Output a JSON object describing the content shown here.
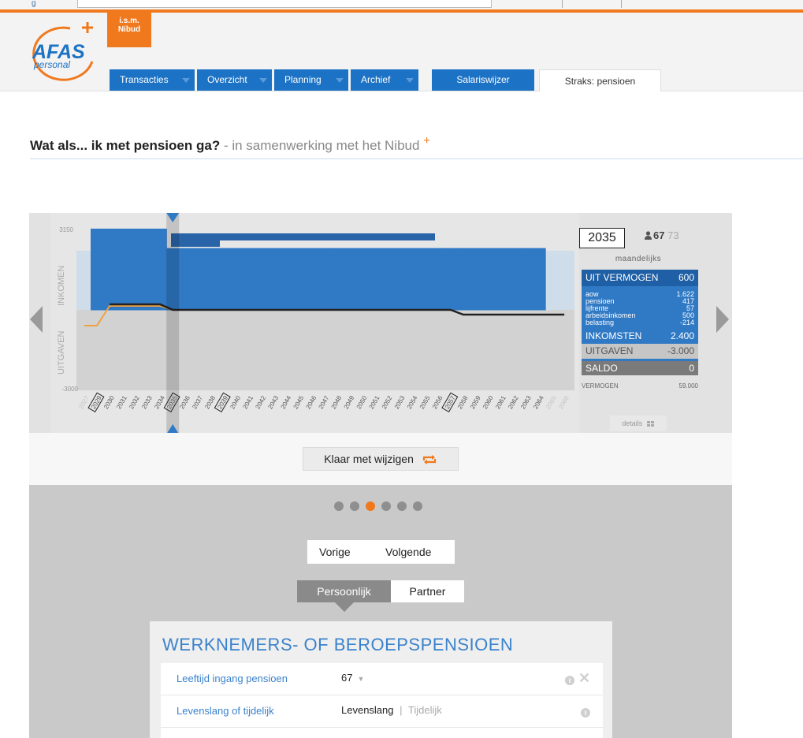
{
  "header": {
    "top_fragment": "g",
    "brand_logo": "AFAS",
    "brand_sub": "personal",
    "badge_line1": "i.s.m.",
    "badge_line2": "Nibud",
    "tabs": [
      {
        "label": "Transacties"
      },
      {
        "label": "Overzicht"
      },
      {
        "label": "Planning"
      },
      {
        "label": "Archief"
      },
      {
        "label": "Salariswijzer"
      },
      {
        "label": "Straks: pensioen"
      }
    ]
  },
  "page": {
    "title_bold": "Wat als... ik met pensioen ga?",
    "title_sub": " - in samenwerking met het Nibud",
    "title_plus": "+"
  },
  "chart_data": {
    "type": "area",
    "ytop_label": "3150",
    "ybottom_label": "-3000",
    "label_inkomen": "INKOMEN",
    "label_uitgaven": "UITGAVEN",
    "ylim": [
      -3000,
      3150
    ],
    "selected_year": "2035",
    "marked_years": [
      "2029",
      "2035",
      "2039",
      "2057"
    ],
    "x": [
      "2027",
      "2029",
      "2030",
      "2031",
      "2032",
      "2033",
      "2034",
      "2035",
      "2036",
      "2037",
      "2038",
      "2039",
      "2040",
      "2041",
      "2042",
      "2043",
      "2044",
      "2045",
      "2046",
      "2047",
      "2048",
      "2049",
      "2050",
      "2051",
      "2052",
      "2053",
      "2054",
      "2055",
      "2056",
      "2057",
      "2058",
      "2059",
      "2060",
      "2061",
      "2062",
      "2063",
      "2064",
      "2065",
      "2066"
    ],
    "series": [
      {
        "name": "inkomsten",
        "values": [
          null,
          3150,
          3150,
          3150,
          3150,
          3150,
          3150,
          2400,
          2400,
          2400,
          2400,
          2400,
          2400,
          2400,
          2400,
          2400,
          2400,
          2400,
          2400,
          2400,
          2400,
          2400,
          2400,
          2400,
          2400,
          2400,
          2400,
          2400,
          2400,
          2400,
          2400,
          2400,
          2400,
          2400,
          2400,
          2400,
          2400,
          null,
          null
        ]
      },
      {
        "name": "uitgaven",
        "values": [
          -300,
          -300,
          -3300,
          -3300,
          -3300,
          -3300,
          -3300,
          -3000,
          -3000,
          -3000,
          -3000,
          -3000,
          -3000,
          -3000,
          -3000,
          -3000,
          -3000,
          -3000,
          -3000,
          -3000,
          -3000,
          -3000,
          -3000,
          -3000,
          -3000,
          -3000,
          -3000,
          -3000,
          -3000,
          -2700,
          -2700,
          -2700,
          -2700,
          -2700,
          -2700,
          -2700,
          -2700,
          -2700,
          -2700
        ]
      }
    ]
  },
  "summary": {
    "year": "2035",
    "age_self": "67",
    "age_partner": "73",
    "period": "maandelijks",
    "uit_vermogen_label": "UIT VERMOGEN",
    "uit_vermogen_value": "600",
    "details": [
      {
        "label": "aow",
        "value": "1.622"
      },
      {
        "label": "pensioen",
        "value": "417"
      },
      {
        "label": "lijfrente",
        "value": "57"
      },
      {
        "label": "arbeidsinkomen",
        "value": "500"
      },
      {
        "label": "belasting",
        "value": "-214"
      }
    ],
    "inkomsten_label": "INKOMSTEN",
    "inkomsten_value": "2.400",
    "uitgaven_label": "UITGAVEN",
    "uitgaven_value": "-3.000",
    "saldo_label": "SALDO",
    "saldo_value": "0",
    "vermogen_label": "VERMOGEN",
    "vermogen_value": "59.000",
    "details_button": "details"
  },
  "controls": {
    "done_button": "Klaar met wijzigen",
    "step_dots": 6,
    "active_step": 3,
    "prev": "Vorige",
    "next": "Volgende",
    "seg_personal": "Persoonlijk",
    "seg_partner": "Partner"
  },
  "form": {
    "title": "WERKNEMERS- OF BEROEPSPENSIOEN",
    "rows": [
      {
        "label": "Leeftijd ingang pensioen",
        "value": "67"
      },
      {
        "label": "Levenslang of tijdelijk",
        "value": "Levenslang",
        "separator": "|",
        "alt": "Tijdelijk"
      }
    ]
  },
  "colors": {
    "orange": "#f0791e",
    "blue": "#2f79c5",
    "dark_blue": "#1e5fa5"
  }
}
